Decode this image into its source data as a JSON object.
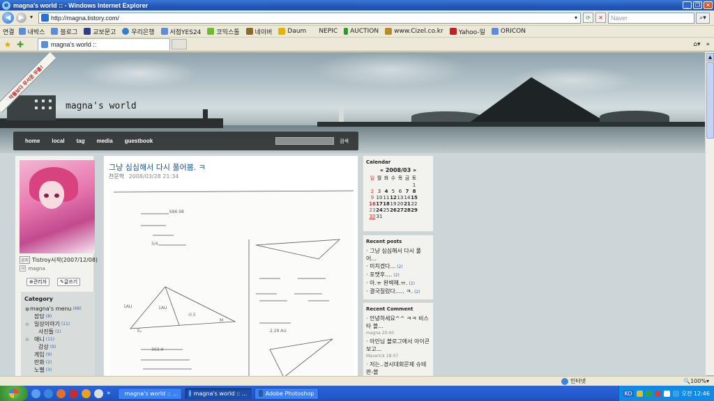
{
  "window": {
    "title": "magna's world :: - Windows Internet Explorer"
  },
  "addressbar": {
    "url": "http://magna.tistory.com/",
    "search_placeholder": "Naver"
  },
  "links": {
    "label": "연결",
    "items": [
      "내박스",
      "블로그",
      "교보문고",
      "우리은행",
      "서점YES24",
      "코믹스톨",
      "네이버",
      "Daum",
      "NEPIC",
      "AUCTION",
      "www.Cizel.co.kr",
      "Yahoo-일",
      "ORICON"
    ]
  },
  "tabs": {
    "active_label": "magna's world ::"
  },
  "blog": {
    "name": "magna's world",
    "ribbon": "악플보다 무서운 무플!",
    "menu": [
      "home",
      "local",
      "tag",
      "media",
      "guestbook"
    ],
    "search_label": "검색"
  },
  "sidebar": {
    "notice_badge": "공지",
    "notice": "Tistroy시작(2007/12/08)",
    "owner": "magna",
    "admin_button": "관리자",
    "write_button": "글쓰기",
    "category_title": "Category",
    "categories": [
      {
        "name": "magna's menu",
        "count": "(68)"
      },
      {
        "name": "잡담",
        "count": "(8)"
      },
      {
        "name": "일상이야기",
        "count": "(11)"
      },
      {
        "name": "사진들",
        "count": "(1)"
      },
      {
        "name": "애니",
        "count": "(11)"
      },
      {
        "name": "감상",
        "count": "(9)"
      },
      {
        "name": "게임",
        "count": "(9)"
      },
      {
        "name": "만화",
        "count": "(2)"
      },
      {
        "name": "노벨",
        "count": "(3)"
      }
    ]
  },
  "post": {
    "title": "그냥 심심해서 다시 풀어봄. ㅋ",
    "author": "찬문학",
    "date": "2008/03/28 21:34"
  },
  "calendar": {
    "title": "Calendar",
    "month": "2008/03",
    "weekdays": [
      "일",
      "월",
      "화",
      "수",
      "목",
      "금",
      "토"
    ],
    "weeks": [
      [
        "",
        "",
        "",
        "",
        "",
        "",
        "1"
      ],
      [
        "2",
        "3",
        "4",
        "5",
        "6",
        "7",
        "8"
      ],
      [
        "9",
        "10",
        "11",
        "12",
        "13",
        "14",
        "15"
      ],
      [
        "16",
        "17",
        "18",
        "19",
        "20",
        "21",
        "22"
      ],
      [
        "23",
        "24",
        "25",
        "26",
        "27",
        "28",
        "29"
      ],
      [
        "30",
        "31",
        "",
        "",
        "",
        "",
        ""
      ]
    ]
  },
  "recent_posts": {
    "title": "Recent posts",
    "items": [
      {
        "text": "그냥 심심해서 다시 풀어...",
        "count": ""
      },
      {
        "text": "미치겠다...",
        "count": "(2)"
      },
      {
        "text": "포맷후....",
        "count": "(2)"
      },
      {
        "text": "아.ㅠ 완벽해.ㅠ.",
        "count": "(2)"
      },
      {
        "text": "결국질렀다..... ㅋ.",
        "count": "(2)"
      }
    ]
  },
  "recent_comments": {
    "title": "Recent Comment",
    "items": [
      {
        "text": "안녕하세요^^ ㅋㅋ 비스타 블...",
        "meta": "magna 20:40"
      },
      {
        "text": "아인님 블로그에서 아이콘보고...",
        "meta": "Maverick 18:57"
      },
      {
        "text": "저는..경시대회문제 슈테판-볼",
        "meta": ""
      }
    ]
  },
  "statusbar": {
    "zone": "인터넷",
    "zoom": "100%"
  },
  "taskbar": {
    "buttons": [
      "magna's world :: ...",
      "magna's world :: ...",
      "Adobe Photoshop"
    ],
    "clock": "오전 12:46",
    "ime": "KO"
  }
}
